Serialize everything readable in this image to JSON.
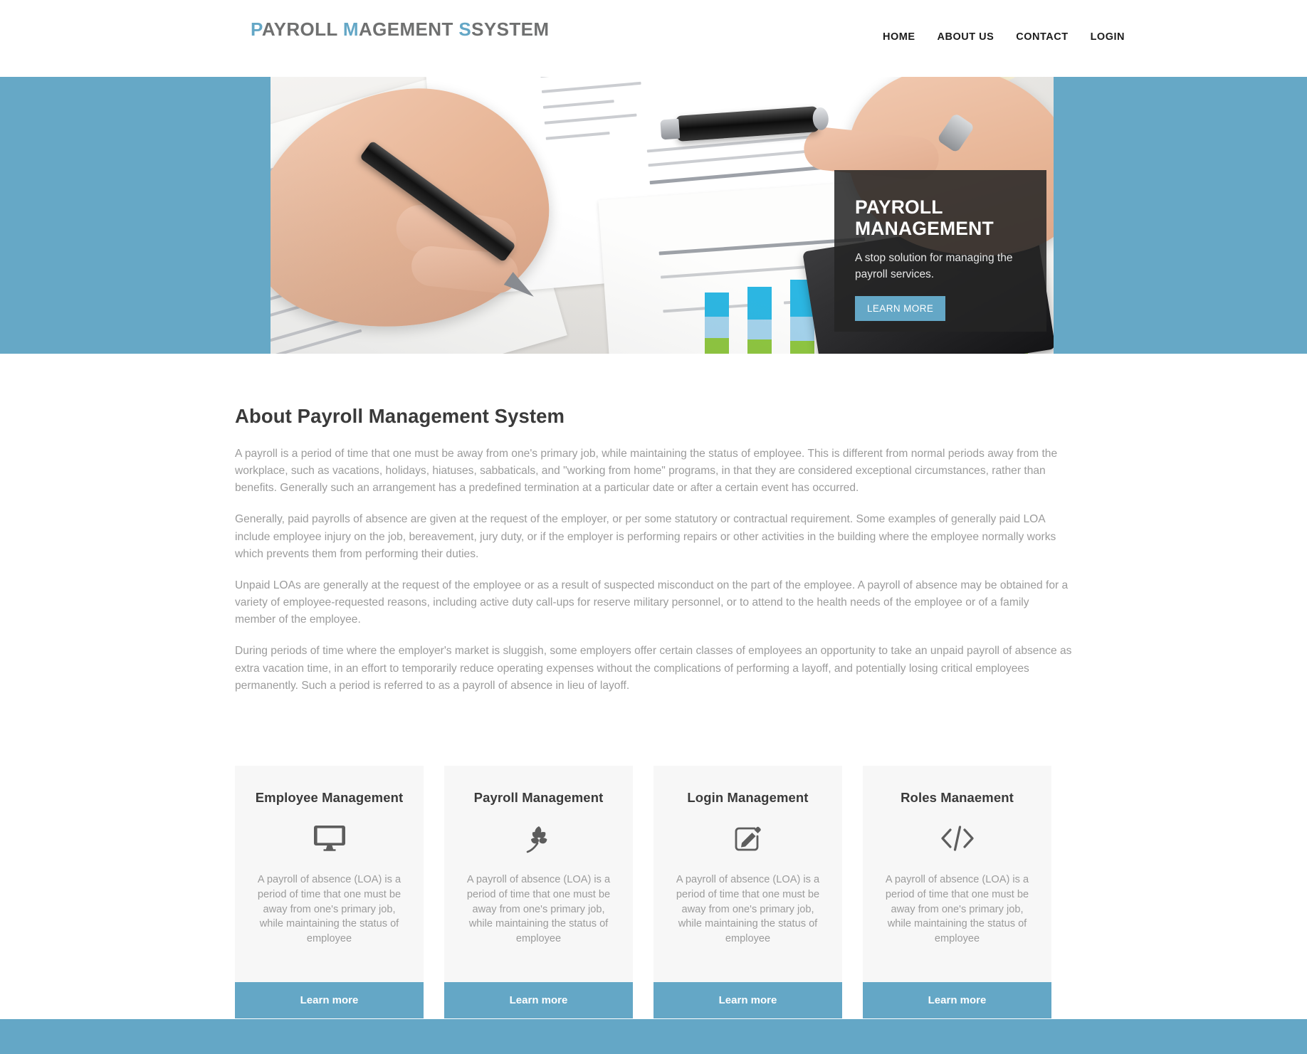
{
  "header": {
    "brand": {
      "parts": [
        {
          "text": "P",
          "accent": true
        },
        {
          "text": "AYROLL ",
          "accent": false
        },
        {
          "text": "M",
          "accent": true
        },
        {
          "text": "AGEMENT ",
          "accent": false
        },
        {
          "text": "S",
          "accent": true
        },
        {
          "text": "SYSTEM",
          "accent": false
        }
      ],
      "full_text": "PAYROLL MAGEMENT SSYSTEM"
    },
    "nav": [
      {
        "label": "HOME"
      },
      {
        "label": "ABOUT US"
      },
      {
        "label": "CONTACT"
      },
      {
        "label": "LOGIN"
      }
    ]
  },
  "hero": {
    "title_line1": "PAYROLL",
    "title_line2": "MANAGEMENT",
    "subtitle": "A stop solution for managing the payroll services.",
    "button_label": "LEARN MORE",
    "image_alt": "hand-holding-pen-over-financial-reports"
  },
  "about": {
    "heading": "About Payroll Management System",
    "paragraphs": [
      "A payroll is a period of time that one must be away from one's primary job, while maintaining the status of employee. This is different from normal periods away from the workplace, such as vacations, holidays, hiatuses, sabbaticals, and \"working from home\" programs, in that they are considered exceptional circumstances, rather than benefits. Generally such an arrangement has a predefined termination at a particular date or after a certain event has occurred.",
      "Generally, paid payrolls of absence are given at the request of the employer, or per some statutory or contractual requirement. Some examples of generally paid LOA include employee injury on the job, bereavement, jury duty, or if the employer is performing repairs or other activities in the building where the employee normally works which prevents them from performing their duties.",
      "Unpaid LOAs are generally at the request of the employee or as a result of suspected misconduct on the part of the employee. A payroll of absence may be obtained for a variety of employee-requested reasons, including active duty call-ups for reserve military personnel, or to attend to the health needs of the employee or of a family member of the employee.",
      "During periods of time where the employer's market is sluggish, some employers offer certain classes of employees an opportunity to take an unpaid payroll of absence as extra vacation time, in an effort to temporarily reduce operating expenses without the complications of performing a layoff, and potentially losing critical employees permanently. Such a period is referred to as a payroll of absence in lieu of layoff."
    ]
  },
  "cards": [
    {
      "title": "Employee Management",
      "icon": "desktop-monitor-icon",
      "text": "A payroll of absence (LOA) is a period of time that one must be away from one's primary job, while maintaining the status of employee",
      "cta": "Learn more"
    },
    {
      "title": "Payroll Management",
      "icon": "leaf-branch-icon",
      "text": "A payroll of absence (LOA) is a period of time that one must be away from one's primary job, while maintaining the status of employee",
      "cta": "Learn more"
    },
    {
      "title": "Login Management",
      "icon": "edit-pencil-square-icon",
      "text": "A payroll of absence (LOA) is a period of time that one must be away from one's primary job, while maintaining the status of employee",
      "cta": "Learn more"
    },
    {
      "title": "Roles Manaement",
      "icon": "code-brackets-icon",
      "text": "A payroll of absence (LOA) is a period of time that one must be away from one's primary job, while maintaining the status of employee",
      "cta": "Learn more"
    }
  ],
  "colors": {
    "accent_blue": "#64a7c6",
    "hero_overlay": "#242424",
    "card_bg": "#f7f7f7",
    "body_text": "#9b9b9b",
    "heading_text": "#3a3a3a"
  }
}
